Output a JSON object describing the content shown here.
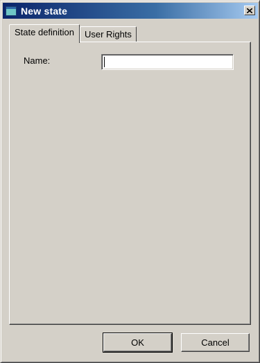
{
  "window": {
    "title": "New state",
    "close_icon": "close-icon"
  },
  "tabs": [
    {
      "label": "State definition",
      "active": true
    },
    {
      "label": "User Rights",
      "active": false
    }
  ],
  "form": {
    "name_label": "Name:",
    "name_value": ""
  },
  "buttons": {
    "ok_label": "OK",
    "cancel_label": "Cancel"
  }
}
